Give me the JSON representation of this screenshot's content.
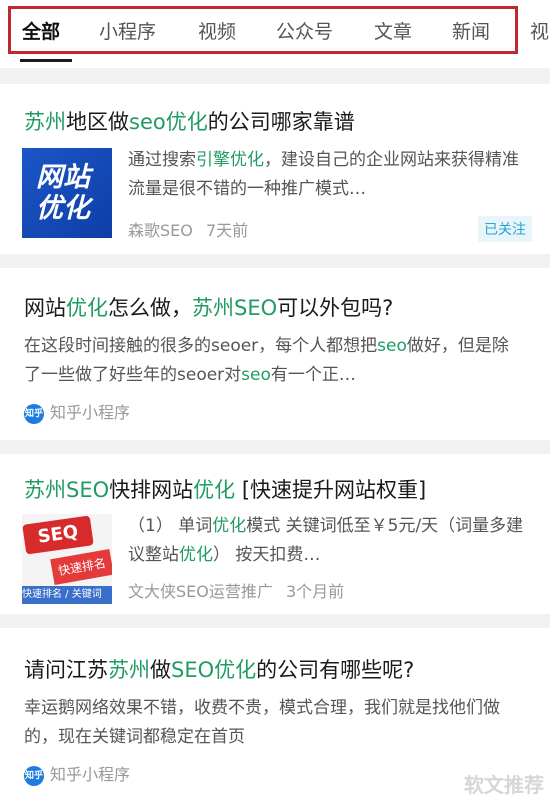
{
  "tabs": [
    "全部",
    "小程序",
    "视频",
    "公众号",
    "文章",
    "新闻",
    "视"
  ],
  "results": [
    {
      "title_parts": [
        [
          "苏州",
          true
        ],
        [
          "地区做",
          false
        ],
        [
          "seo优化",
          true
        ],
        [
          "的公司哪家靠谱",
          false
        ]
      ],
      "thumb_text": [
        "网站",
        "优化"
      ],
      "snippet_parts": [
        [
          "通过搜索",
          false
        ],
        [
          "引擎优化",
          true
        ],
        [
          "，建设自己的企业网站来获得精准流量是很不错的一种推广模式…",
          false
        ]
      ],
      "source": "森歌SEO",
      "time": "7天前",
      "badge": "已关注"
    },
    {
      "title_parts": [
        [
          "网站",
          false
        ],
        [
          "优化",
          true
        ],
        [
          "怎么做，",
          false
        ],
        [
          "苏州SEO",
          true
        ],
        [
          "可以外包吗?",
          false
        ]
      ],
      "snippet_parts": [
        [
          "在这段时间接触的很多的seoer，每个人都想把",
          false
        ],
        [
          "seo",
          true
        ],
        [
          "做好，但是除了一些做了好些年的seoer对",
          false
        ],
        [
          "seo",
          true
        ],
        [
          "有一个正…",
          false
        ]
      ],
      "source_icon": "知乎",
      "source": "知乎小程序"
    },
    {
      "title_parts": [
        [
          "苏州SEO",
          true
        ],
        [
          "快排网站",
          false
        ],
        [
          "优化",
          true
        ],
        [
          " [快速提升网站权重]",
          false
        ]
      ],
      "thumb_text": [
        "SEQ",
        "快速排名",
        "快速排名 / 关键词"
      ],
      "snippet_parts": [
        [
          "（1） 单词",
          false
        ],
        [
          "优化",
          true
        ],
        [
          "模式 关键词低至￥5元/天（词量多建议整站",
          false
        ],
        [
          "优化",
          true
        ],
        [
          "） 按天扣费…",
          false
        ]
      ],
      "source": "文大侠SEO运营推广",
      "time": "3个月前"
    },
    {
      "title_parts": [
        [
          "请问江苏",
          false
        ],
        [
          "苏州",
          true
        ],
        [
          "做",
          false
        ],
        [
          "SEO优化",
          true
        ],
        [
          "的公司有哪些呢?",
          false
        ]
      ],
      "snippet_parts": [
        [
          "幸运鹅网络效果不错，收费不贵，模式合理，我们就是找他们做的，现在关键词都稳定在首页",
          false
        ]
      ],
      "source_icon": "知乎",
      "source": "知乎小程序"
    }
  ],
  "watermark": "软文推荐"
}
